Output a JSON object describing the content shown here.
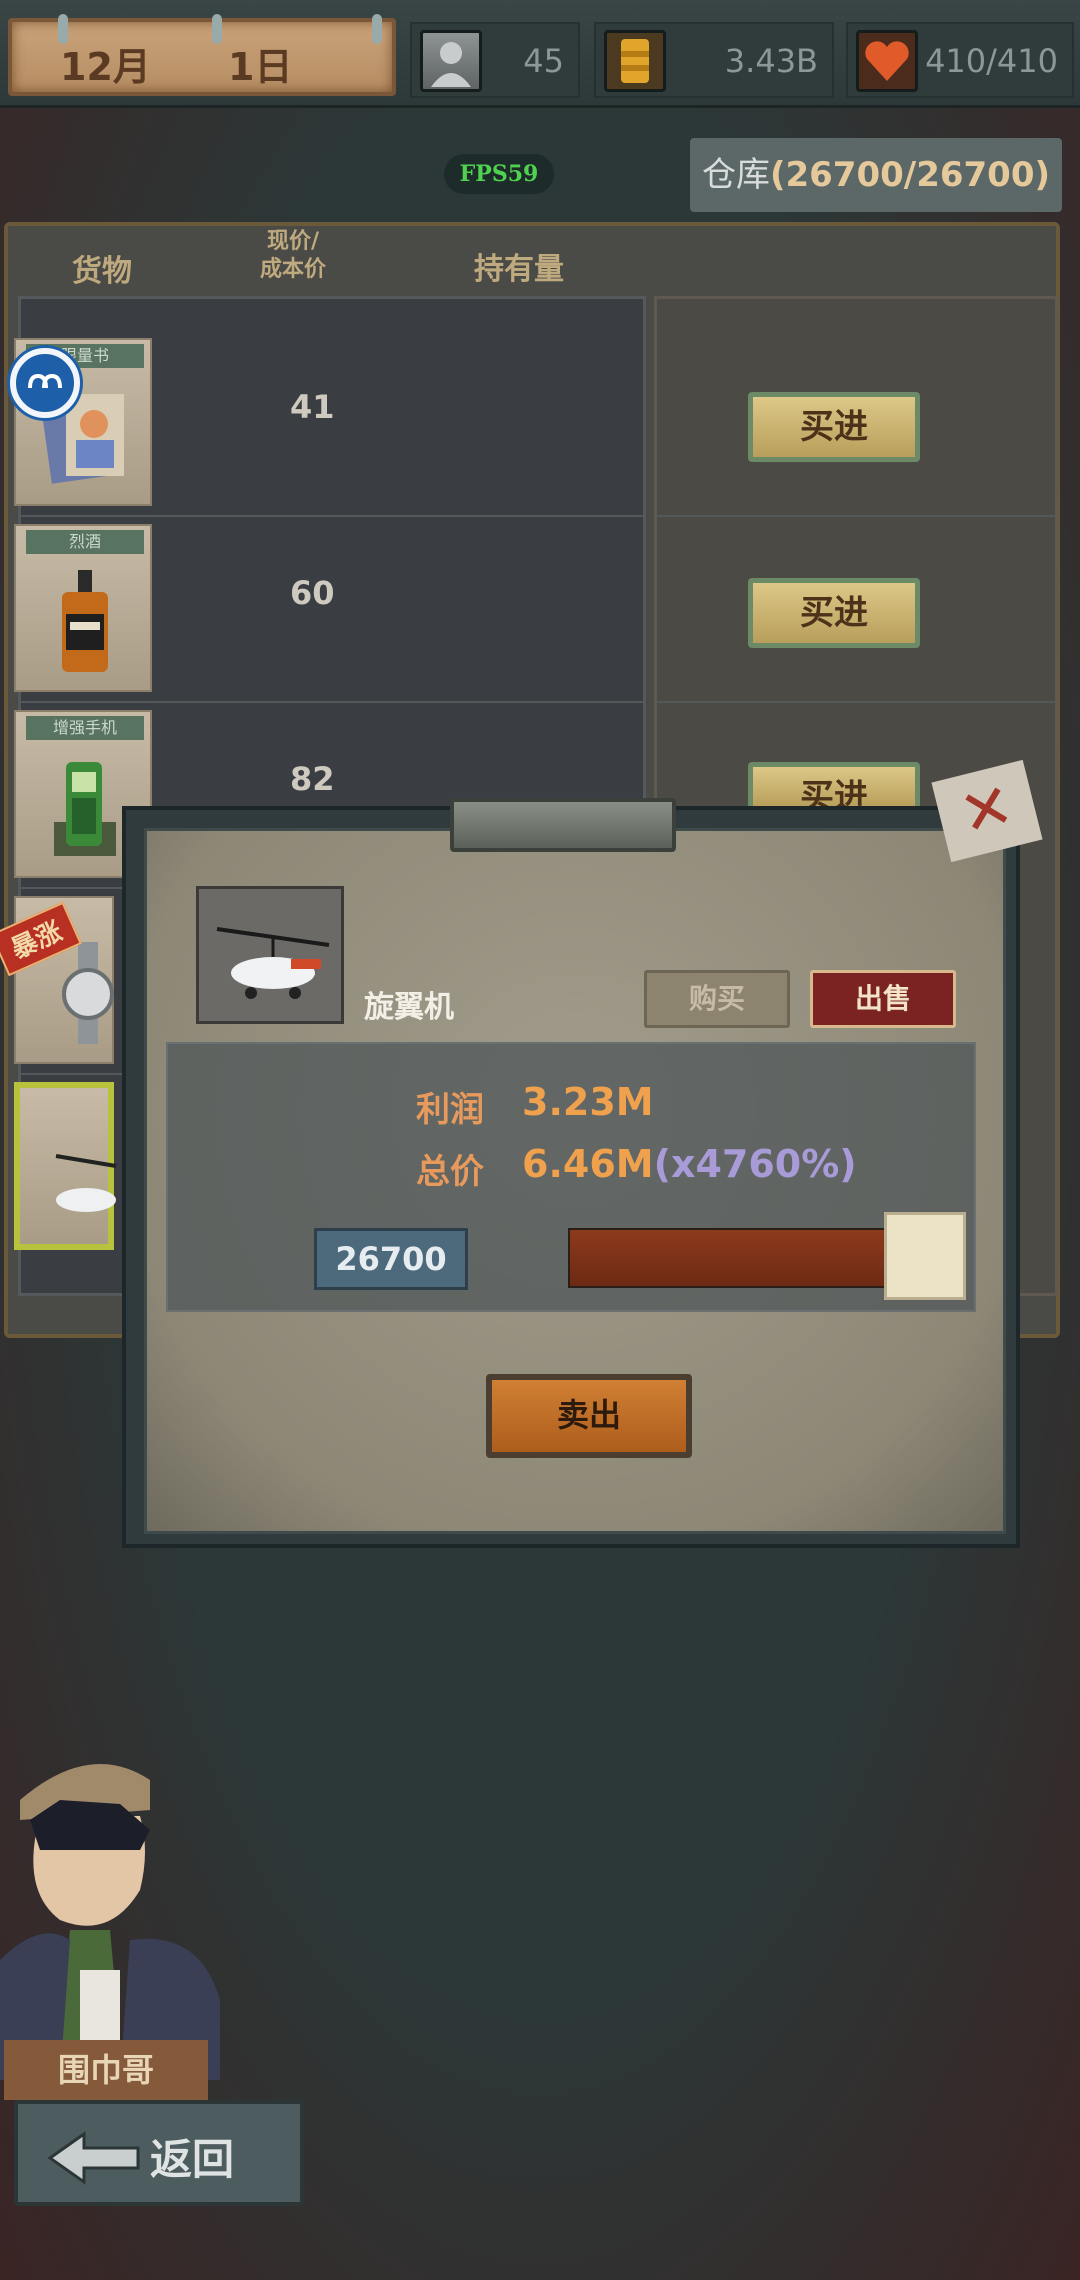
{
  "topbar": {
    "month": "12月",
    "day": "1日",
    "stats": [
      {
        "icon": "player-icon",
        "value": "45"
      },
      {
        "icon": "money-barrel-icon",
        "value": "3.43B"
      },
      {
        "icon": "health-heart-icon",
        "value": "410/410"
      }
    ]
  },
  "fps": "FPS59",
  "warehouse": {
    "label": "仓库",
    "value": "(26700/26700)"
  },
  "columns": {
    "goods": "货物",
    "price_line1": "现价/",
    "price_line2": "成本价",
    "holding": "持有量"
  },
  "items": [
    {
      "tag": "限量书",
      "price": "41",
      "buy": "买进"
    },
    {
      "tag": "烈酒",
      "price": "60",
      "buy": "买进"
    },
    {
      "tag": "增强手机",
      "price": "82",
      "buy": "买进"
    }
  ],
  "surge_badge": "暴涨",
  "modal": {
    "product_name": "旋翼机",
    "buy_tab": "购买",
    "sell_tab": "出售",
    "profit_label": "利润",
    "profit_value": "3.23M",
    "total_label": "总价",
    "total_value": "6.46M",
    "total_pct": "(x4760%)",
    "quantity": "26700",
    "slider_level": 1.0,
    "action": "卖出"
  },
  "npc_name": "围巾哥",
  "back_label": "返回",
  "colors": {
    "accent_orange": "#f0a14d",
    "fps_green": "#4fd34f",
    "sell_red": "#7a2322"
  }
}
